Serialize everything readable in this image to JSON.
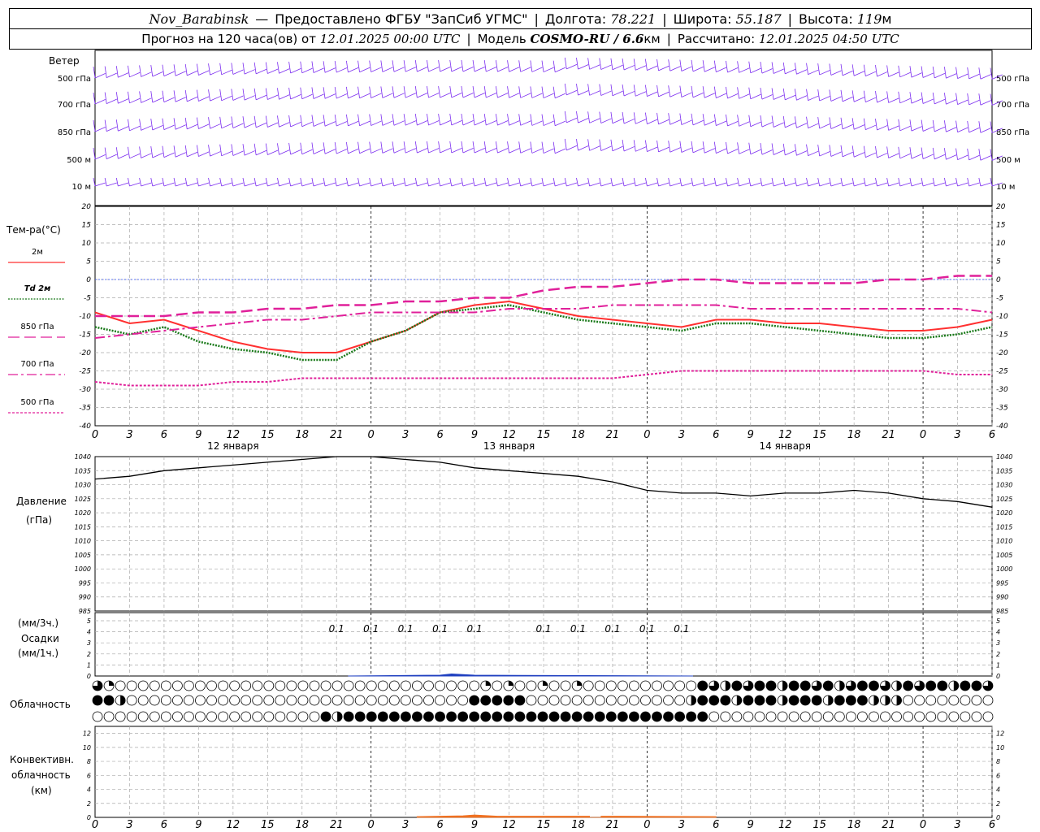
{
  "header": {
    "station": "Nov_Barabinsk",
    "dash": "—",
    "provider": "Предоставлено ФГБУ \"ЗапСиб УГМС\"",
    "lon_label": "Долгота:",
    "lon": "78.221",
    "lat_label": "Широта:",
    "lat": "55.187",
    "alt_label": "Высота:",
    "alt": "119",
    "alt_unit": "м",
    "forecast_label": "Прогноз на 120 часа(ов) от",
    "forecast_start": "12.01.2025 00:00 UTC",
    "model_label": "Модель",
    "model": "COSMO-RU / 6.6",
    "model_unit": "км",
    "calc_label": "Рассчитано:",
    "calc_time": "12.01.2025 04:50 UTC"
  },
  "wind_panel": {
    "title": "Ветер",
    "levels": [
      "500 гПа",
      "700 гПа",
      "850 гПа",
      "500 м",
      "10 м"
    ],
    "color": "#7b2cf0"
  },
  "temp_panel": {
    "title": "Тем-ра(°С)",
    "legend": [
      {
        "label": "2м",
        "color": "#ff3030",
        "style": "solid"
      },
      {
        "label": "Td 2м",
        "color": "#1a7a1a",
        "style": "dotted"
      },
      {
        "label": "850 гПа",
        "color": "#e0209a",
        "style": "dash"
      },
      {
        "label": "700 гПа",
        "color": "#e0209a",
        "style": "dashdot"
      },
      {
        "label": "500 гПа",
        "color": "#e0209a",
        "style": "dotted"
      }
    ],
    "yticks": [
      "20",
      "15",
      "10",
      "5",
      "0",
      "-5",
      "-10",
      "-15",
      "-20",
      "-25",
      "-30",
      "-35",
      "-40"
    ]
  },
  "time_axis": {
    "ticks": [
      "0",
      "3",
      "6",
      "9",
      "12",
      "15",
      "18",
      "21",
      "0",
      "3",
      "6",
      "9",
      "12",
      "15",
      "18",
      "21",
      "0",
      "3",
      "6",
      "9",
      "12",
      "15",
      "18",
      "21",
      "0",
      "3",
      "6"
    ],
    "days": [
      "12 января",
      "13 января",
      "14 января"
    ]
  },
  "pressure_panel": {
    "title": "Давление",
    "unit": "(гПа)",
    "yticks": [
      "1040",
      "1035",
      "1030",
      "1025",
      "1020",
      "1015",
      "1010",
      "1005",
      "1000",
      "995",
      "990",
      "985"
    ]
  },
  "precip_panel": {
    "unit3": "(мм/3ч.)",
    "title": "Осадки",
    "unit1": "(мм/1ч.)",
    "yticks": [
      "5",
      "4",
      "3",
      "2",
      "1",
      "0"
    ],
    "labels": [
      "0.1",
      "0.1",
      "0.1",
      "0.1",
      "0.1",
      "0.1",
      "0.1",
      "0.1",
      "0.1",
      "0.1"
    ]
  },
  "cloud_panel": {
    "title": "Облачность"
  },
  "conv_panel": {
    "title1": "Конвективн.",
    "title2": "облачность",
    "unit": "(км)",
    "yticks": [
      "12",
      "10",
      "8",
      "6",
      "4",
      "2",
      "0"
    ]
  },
  "chart_data": [
    {
      "type": "line",
      "title": "Тем-ра(°С)",
      "x_hours": [
        0,
        3,
        6,
        9,
        12,
        15,
        18,
        21,
        24,
        27,
        30,
        33,
        36,
        39,
        42,
        45,
        48,
        51,
        54,
        57,
        60,
        63,
        66,
        69,
        72,
        75,
        78
      ],
      "ylim": [
        -40,
        20
      ],
      "series": [
        {
          "name": "2м",
          "values": [
            -9,
            -12,
            -11,
            -14,
            -17,
            -19,
            -20,
            -20,
            -17,
            -14,
            -9,
            -7,
            -6,
            -8,
            -10,
            -11,
            -12,
            -13,
            -11,
            -11,
            -12,
            -12,
            -13,
            -14,
            -14,
            -13,
            -11
          ]
        },
        {
          "name": "Td 2м",
          "values": [
            -13,
            -15,
            -13,
            -17,
            -19,
            -20,
            -22,
            -22,
            -17,
            -14,
            -9,
            -8,
            -7,
            -9,
            -11,
            -12,
            -13,
            -14,
            -12,
            -12,
            -13,
            -14,
            -15,
            -16,
            -16,
            -15,
            -13
          ]
        },
        {
          "name": "850 гПа",
          "values": [
            -10,
            -10,
            -10,
            -9,
            -9,
            -8,
            -8,
            -7,
            -7,
            -6,
            -6,
            -5,
            -5,
            -3,
            -2,
            -2,
            -1,
            0,
            0,
            -1,
            -1,
            -1,
            -1,
            0,
            0,
            1,
            1
          ]
        },
        {
          "name": "700 гПа",
          "values": [
            -16,
            -15,
            -14,
            -13,
            -12,
            -11,
            -11,
            -10,
            -9,
            -9,
            -9,
            -9,
            -8,
            -8,
            -8,
            -7,
            -7,
            -7,
            -7,
            -8,
            -8,
            -8,
            -8,
            -8,
            -8,
            -8,
            -9
          ]
        },
        {
          "name": "500 гПа",
          "values": [
            -28,
            -29,
            -29,
            -29,
            -28,
            -28,
            -27,
            -27,
            -27,
            -27,
            -27,
            -27,
            -27,
            -27,
            -27,
            -27,
            -26,
            -25,
            -25,
            -25,
            -25,
            -25,
            -25,
            -25,
            -25,
            -26,
            -26
          ]
        }
      ]
    },
    {
      "type": "line",
      "title": "Давление",
      "x_hours": [
        0,
        3,
        6,
        9,
        12,
        15,
        18,
        21,
        24,
        27,
        30,
        33,
        36,
        39,
        42,
        45,
        48,
        51,
        54,
        57,
        60,
        63,
        66,
        69,
        72,
        75,
        78
      ],
      "ylim": [
        985,
        1040
      ],
      "series": [
        {
          "name": "Давление",
          "values": [
            1032,
            1033,
            1035,
            1036,
            1037,
            1038,
            1039,
            1040,
            1040,
            1039,
            1038,
            1036,
            1035,
            1034,
            1033,
            1031,
            1028,
            1027,
            1027,
            1026,
            1027,
            1027,
            1028,
            1027,
            1025,
            1024,
            1022
          ]
        }
      ]
    }
  ]
}
